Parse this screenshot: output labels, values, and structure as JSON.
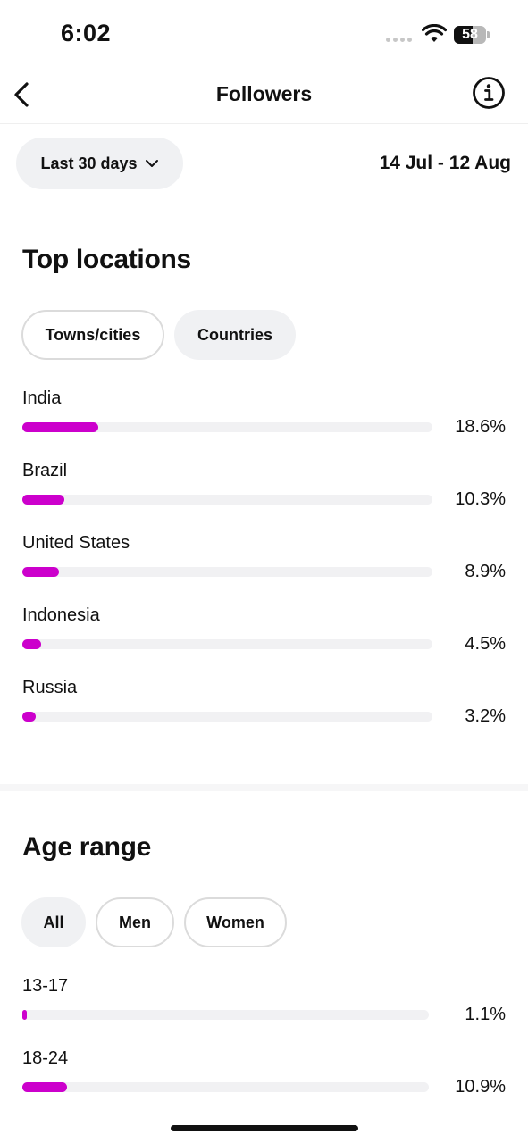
{
  "status_bar": {
    "time": "6:02",
    "battery": "58",
    "battery_level": 0.58
  },
  "nav": {
    "title": "Followers"
  },
  "period": {
    "label": "Last 30 days",
    "date_range": "14 Jul - 12 Aug"
  },
  "top_locations": {
    "title": "Top locations",
    "tabs": [
      "Towns/cities",
      "Countries"
    ],
    "rows": [
      {
        "label": "India",
        "pct": "18.6%",
        "value": 18.6
      },
      {
        "label": "Brazil",
        "pct": "10.3%",
        "value": 10.3
      },
      {
        "label": "United States",
        "pct": "8.9%",
        "value": 8.9
      },
      {
        "label": "Indonesia",
        "pct": "4.5%",
        "value": 4.5
      },
      {
        "label": "Russia",
        "pct": "3.2%",
        "value": 3.2
      }
    ]
  },
  "age_range": {
    "title": "Age range",
    "tabs": [
      "All",
      "Men",
      "Women"
    ],
    "rows": [
      {
        "label": "13-17",
        "pct": "1.1%",
        "value": 1.1
      },
      {
        "label": "18-24",
        "pct": "10.9%",
        "value": 10.9
      }
    ]
  },
  "colors": {
    "accent": "#cc00cc",
    "track": "#f1f1f3",
    "chip_bg": "#f0f1f3"
  }
}
